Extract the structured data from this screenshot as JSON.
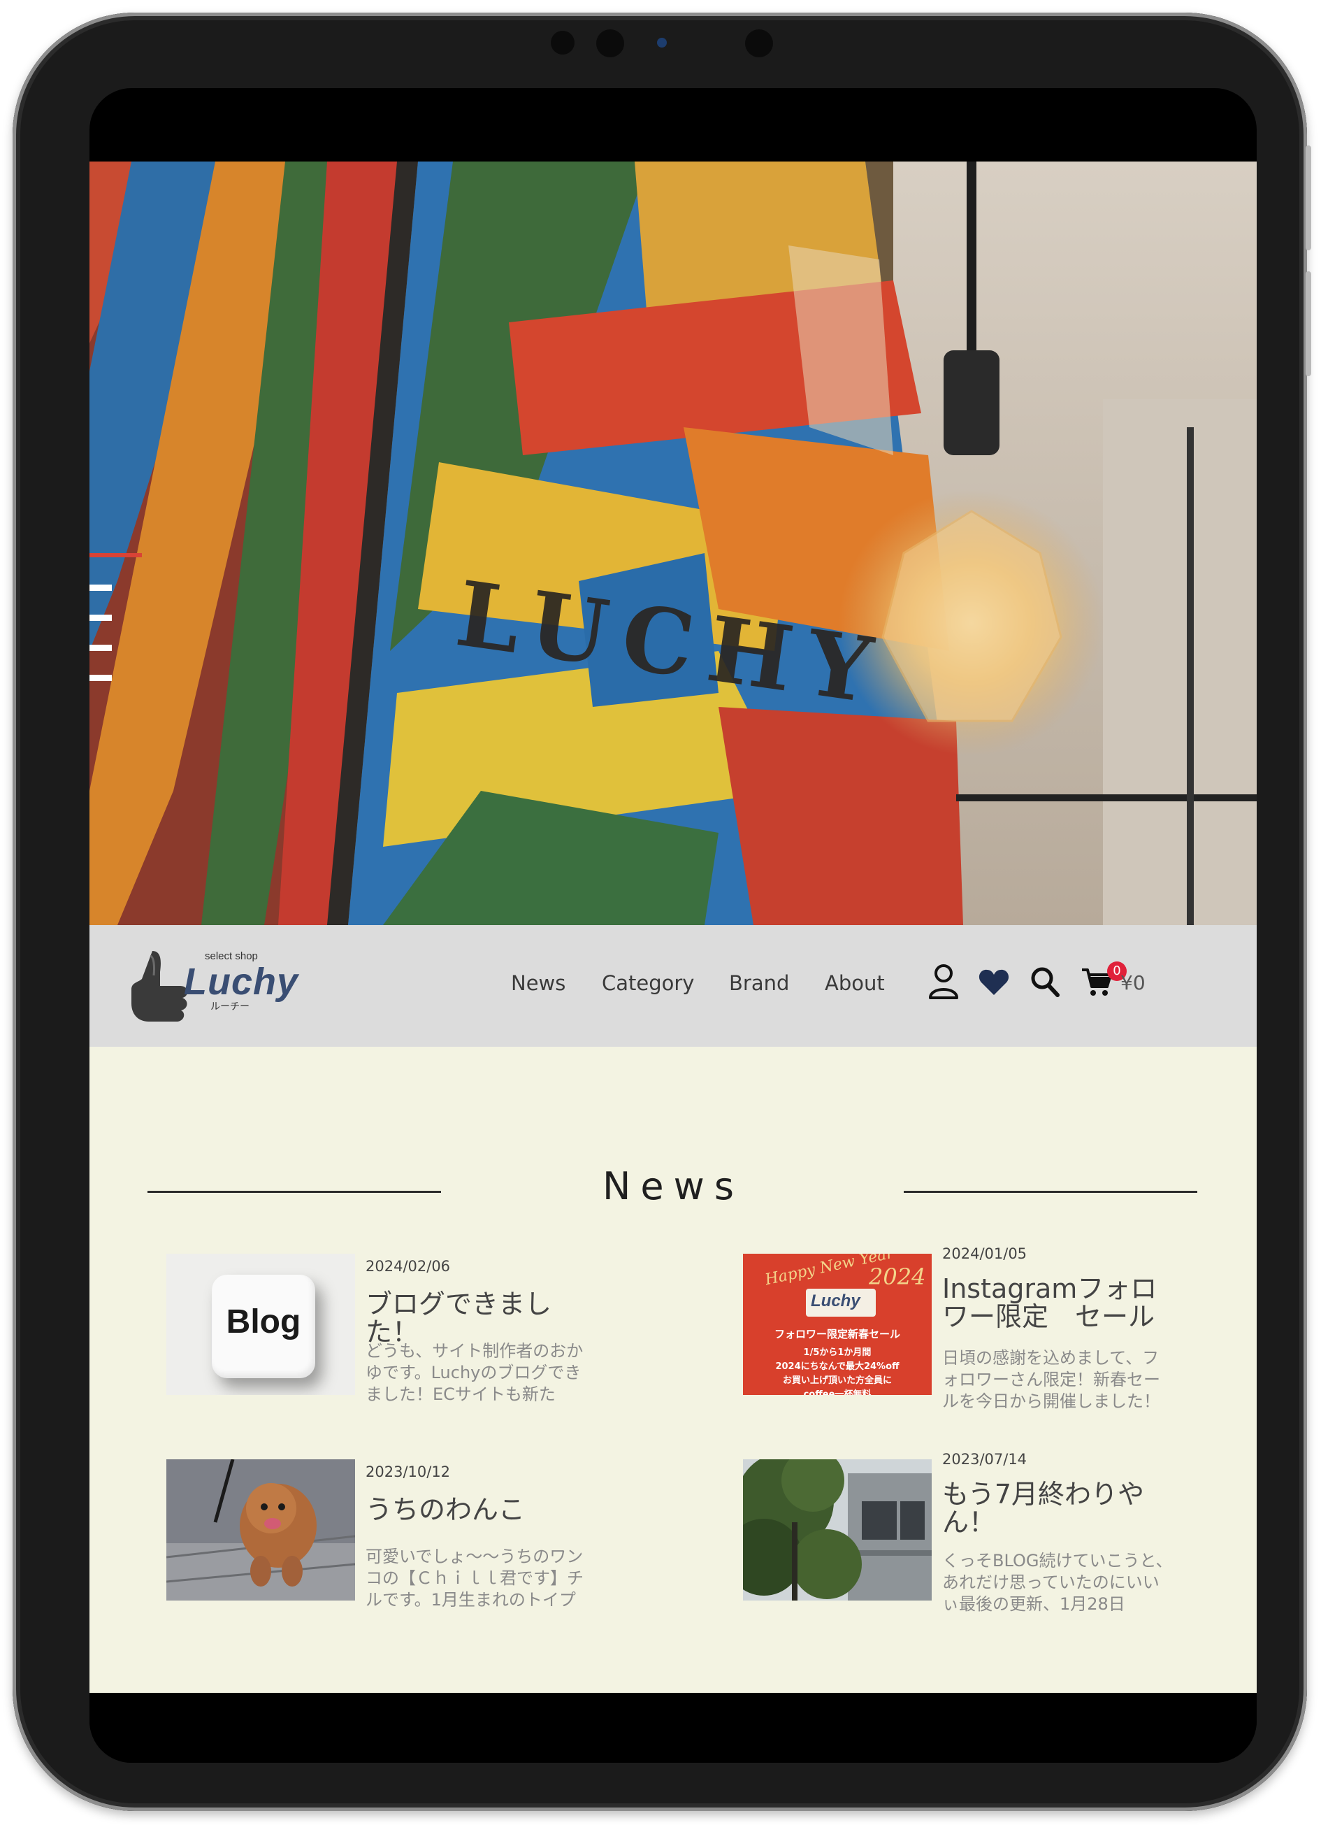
{
  "hero": {
    "wall_lettering": "LUCHY"
  },
  "header": {
    "logo": {
      "tagline": "select shop",
      "name": "Luchy",
      "kana": "ルーチー"
    },
    "nav": [
      "News",
      "Category",
      "Brand",
      "About"
    ],
    "icons": [
      "user-icon",
      "heart-icon",
      "search-icon",
      "cart-icon"
    ],
    "cart_count": "0",
    "cart_total": "¥0"
  },
  "news": {
    "heading": "News",
    "items": [
      {
        "date": "2024/02/06",
        "title": "ブログできました！",
        "excerpt": "どうも、サイト制作者のおかゆです。Luchyのブログできました！ECサイトも新た",
        "thumb_text": "Blog"
      },
      {
        "date": "2024/01/05",
        "title": "Instagramフォロワー限定　セール",
        "excerpt": "日頃の感謝を込めまして、フォロワーさん限定！新春セールを今日から開催しました！",
        "thumb": {
          "script": "Happy New Year",
          "year": "2024",
          "brand": "Luchy",
          "headline": "フォロワー限定新春セール",
          "line1": "1/5から1か月間",
          "line2": "2024にちなんで最大24%off",
          "line3": "お買い上げ頂いた方全員に",
          "line4": "coffee一杯無料"
        }
      },
      {
        "date": "2023/10/12",
        "title": "うちのわんこ",
        "excerpt": "可愛いでしょ〜〜うちのワンコの【Ｃｈｉｌｌ君です】チルです。1月生まれのトイプ"
      },
      {
        "date": "2023/07/14",
        "title": "もう7月終わりやん！",
        "excerpt": "くっそBLOG続けていこうと、あれだけ思っていたのにいいぃ最後の更新、1月28日"
      }
    ]
  },
  "colors": {
    "header_bg": "#dcdcdc",
    "news_bg": "#f3f3e2",
    "badge": "#e0213a",
    "heart": "#1f2f52",
    "menu_accent": "#d94336"
  }
}
